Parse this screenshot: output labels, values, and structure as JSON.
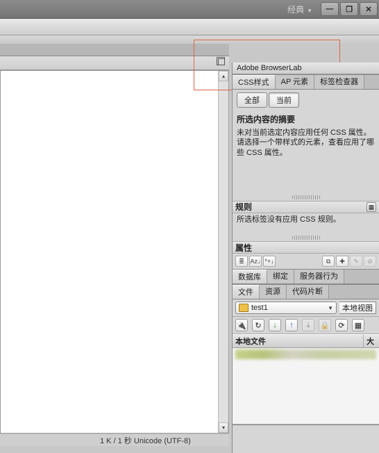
{
  "topbar": {
    "layout_label": "经典"
  },
  "window": {
    "minimize": "—",
    "restore": "❐",
    "close": "✕"
  },
  "panels": {
    "browserlab_title": "Adobe BrowserLab",
    "css_tabs": {
      "css": "CSS样式",
      "ap": "AP 元素",
      "tag": "标签检查器"
    },
    "summary_tabs": {
      "all": "全部",
      "current": "当前"
    },
    "summary_header": "所选内容的摘要",
    "summary_body_l1": "未对当前选定内容应用任何 CSS 属性。",
    "summary_body_l2": "请选择一个带样式的元素，查看应用了哪些 CSS 属性。",
    "rules_header": "规则",
    "rules_body": "所选标签没有应用 CSS 规则。",
    "props_header": "属性",
    "props_icons": {
      "cascade": "≣",
      "az": "Aᴢ↓",
      "star": "*+↓",
      "link": "⧉",
      "new": "✚",
      "edit": "✎",
      "disable": "⊘"
    },
    "assets_tabs": {
      "db": "数据库",
      "bind": "绑定",
      "server": "服务器行为"
    },
    "files_tabs": {
      "files": "文件",
      "assets": "资源",
      "snippets": "代码片断"
    },
    "site_name": "test1",
    "view_label": "本地视图",
    "file_icons": {
      "connect": "🔌",
      "refresh": "↻",
      "get": "↓",
      "put": "↑",
      "checkout": "⤓",
      "checkin": "🔒",
      "sync": "⟳",
      "expand": "▦"
    },
    "local_col1": "本地文件",
    "local_col2": "大"
  },
  "status": "1 K / 1 秒 Unicode (UTF-8)"
}
